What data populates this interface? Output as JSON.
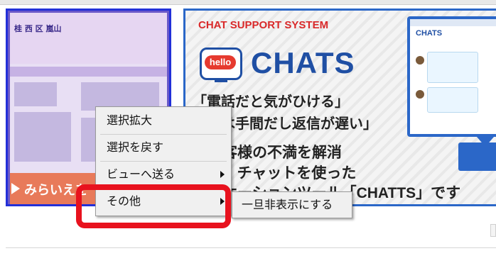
{
  "left_thumbnail": {
    "logo_text": "桂 西 区 嵐山",
    "band_text": "みらいえを"
  },
  "banner": {
    "title": "CHAT SUPPORT SYSTEM",
    "hello": "hello",
    "brand": "CHATS",
    "line1": "「電話だと気がひける」",
    "line2": "ールは手間だし返信が遅い」",
    "line3": "なお客様の不満を解消",
    "line4": "のが、チャットを使った",
    "line5": "ュニケーションツール「CHATTS」です",
    "mini_window_logo": "CHATS"
  },
  "context_menu": {
    "items": [
      {
        "label": "選択拡大",
        "submenu": false
      },
      {
        "label": "選択を戻す",
        "submenu": false
      },
      {
        "label": "ビューへ送る",
        "submenu": true
      },
      {
        "label": "その他",
        "submenu": true
      }
    ],
    "submenu_item": "一旦非表示にする"
  },
  "highlight_color": "#e8121e"
}
